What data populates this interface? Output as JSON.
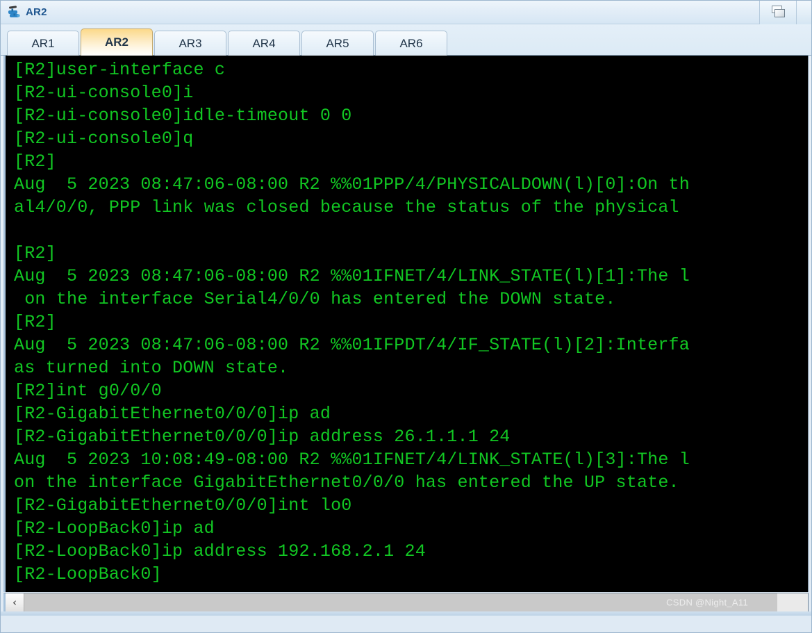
{
  "window": {
    "title": "AR2",
    "icon": "router-device-icon",
    "restore_button_label": "Restore",
    "restore_icon": "restore-window-icon"
  },
  "tabs": [
    {
      "label": "AR1",
      "active": false
    },
    {
      "label": "AR2",
      "active": true
    },
    {
      "label": "AR3",
      "active": false
    },
    {
      "label": "AR4",
      "active": false
    },
    {
      "label": "AR5",
      "active": false
    },
    {
      "label": "AR6",
      "active": false
    }
  ],
  "terminal": {
    "text_color": "#12c723",
    "background_color": "#000000",
    "lines": [
      "[R2]user-interface c",
      "[R2-ui-console0]i",
      "[R2-ui-console0]idle-timeout 0 0",
      "[R2-ui-console0]q",
      "[R2]",
      "Aug  5 2023 08:47:06-08:00 R2 %%01PPP/4/PHYSICALDOWN(l)[0]:On th",
      "al4/0/0, PPP link was closed because the status of the physical",
      "",
      "[R2]",
      "Aug  5 2023 08:47:06-08:00 R2 %%01IFNET/4/LINK_STATE(l)[1]:The l",
      " on the interface Serial4/0/0 has entered the DOWN state.",
      "[R2]",
      "Aug  5 2023 08:47:06-08:00 R2 %%01IFPDT/4/IF_STATE(l)[2]:Interfa",
      "as turned into DOWN state.",
      "[R2]int g0/0/0",
      "[R2-GigabitEthernet0/0/0]ip ad",
      "[R2-GigabitEthernet0/0/0]ip address 26.1.1.1 24",
      "Aug  5 2023 10:08:49-08:00 R2 %%01IFNET/4/LINK_STATE(l)[3]:The l",
      "on the interface GigabitEthernet0/0/0 has entered the UP state.",
      "[R2-GigabitEthernet0/0/0]int lo0",
      "[R2-LoopBack0]ip ad",
      "[R2-LoopBack0]ip address 192.168.2.1 24",
      "[R2-LoopBack0]"
    ]
  },
  "scrollbar": {
    "left_arrow": "‹",
    "left_arrow_icon": "chevron-left-icon"
  },
  "watermark": {
    "text": "CSDN @Night_A11"
  }
}
